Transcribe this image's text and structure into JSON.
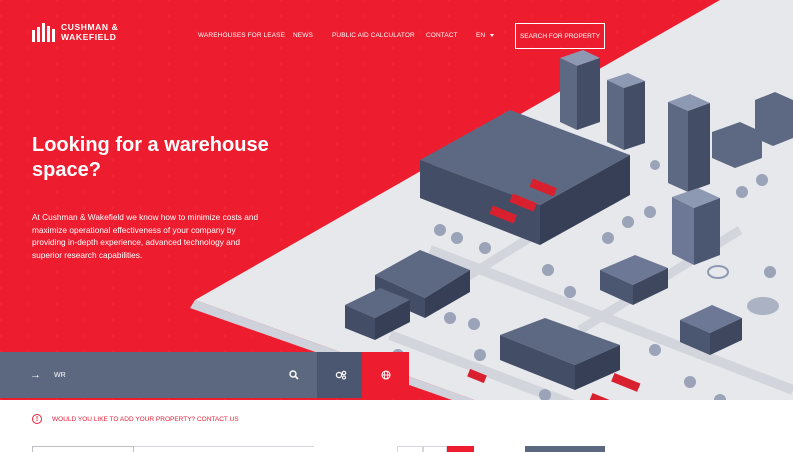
{
  "brand": {
    "line1": "CUSHMAN &",
    "line2": "WAKEFIELD",
    "color": "#ed1c2e"
  },
  "nav": {
    "items": [
      "WAREHOUSES FOR LEASE",
      "NEWS",
      "PUBLIC AID CALCULATOR",
      "CONTACT",
      "EN"
    ],
    "cta": "SEARCH FOR PROPERTY"
  },
  "hero": {
    "headline": "Looking for a warehouse space?",
    "lead": "At Cushman & Wakefield we know how to minimize costs and maximize operational effectiveness of your company by providing in-depth experience, advanced technology and superior research capabilities."
  },
  "search": {
    "value": "WR",
    "search_icon": "search-icon",
    "filter_icon": "filter-cogs-icon",
    "globe_icon": "globe-icon"
  },
  "info": {
    "text": "WOULD YOU LIKE TO ADD YOUR PROPERTY? CONTACT US",
    "icon": "info-icon"
  },
  "colors": {
    "accent": "#ed1c2e",
    "slate": "#5c6780",
    "slate_dark": "#4b5670"
  }
}
